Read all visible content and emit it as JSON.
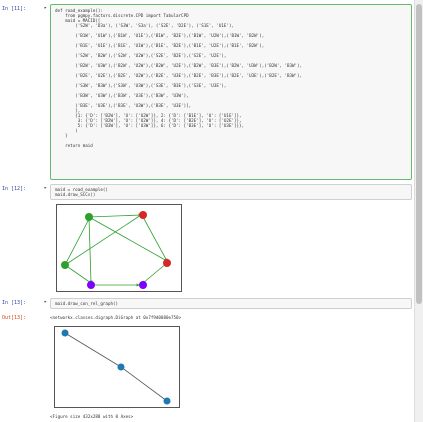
{
  "cells": [
    {
      "prompt": "In [11]:",
      "lines": [
        "def road_example():",
        "    from pgmpy.factors.discrete.CPD import TabularCPD",
        "    maid = MACID([",
        "        ('S2W', 'D3a'), ('S3W', 'S3a'), ('S2E', 'D2E'), ('S1E', 'U1E'),",
        "",
        "        ('B1W', 'U1W'),('B1W', 'U1E'),('B1W', 'B2E'),('B1W', 'U2W'),('B1W', 'B2W'),",
        "",
        "        ('B1E', 'U1E'),('B1E', 'U1W'),('B1E', 'B2E'),('B1E', 'U2E'),('B1E', 'B2W'),",
        "",
        "        ('S2W', 'B2W'),('S2W', 'U2W'),('S2E', 'B2E'),('S2E', 'U2E'),",
        "",
        "        ('B2W', 'U3W'),('B2W', 'U2W'),('B2W', 'U2E'),('B2W', 'B3E'),('B2W', 'U3W'),('B2W', 'B3W'),",
        "",
        "        ('B2E', 'U2E'),('B2E', 'U2W'),('B2E', 'U3E'),('B2E', 'B3E'),('B2E', 'U3E'),('B2E', 'B3W'),",
        "",
        "        ('S3W', 'B3W'),('S3W', 'U3W'),('S3E', 'B3E'),('S3E', 'U3E'),",
        "",
        "        ('B3W', 'U3W'),('B3W', 'U3E'),('B3W', 'U3W'),",
        "",
        "        ('B3E', 'U3E'),('B3E', 'U3W'),('B3E', 'U3E')],",
        "        ],",
        "        {1: {'D': ['B2W'], 'U': ['U2W']}, 2: {'D': ['B1E'], 'U': ['U1E']},",
        "         3: {'D': ['B2W'], 'U': ['U2W']}, 4: {'D': ['B2E'], 'U': ['U2E']},",
        "         5: {'D': ['B3W'], 'U': ['U3W']}, 6: {'D': ['B3E'], 'U': ['U3E']}},",
        "        )",
        "    }",
        "",
        "    return maid"
      ]
    },
    {
      "prompt": "In [12]:",
      "lines": [
        "maid = road_example()",
        "maid.draw_SCCs()"
      ]
    },
    {
      "prompt": "In [13]:",
      "lines": [
        "maid.draw_con_rel_graph()"
      ],
      "out_prompt": "Out[13]:",
      "out_text": "<networkx.classes.digraph.DiGraph at 0x7f9d0080e750>",
      "figure_text": "<Figure size 432x288 with 0 Axes>"
    }
  ],
  "colors": {
    "green_node": "#2ca02c",
    "red_node": "#d62728",
    "purple_node": "#7f00ff",
    "blue_node": "#1f77b4",
    "edge_green": "#2ca02c",
    "edge_gray": "#555555"
  }
}
